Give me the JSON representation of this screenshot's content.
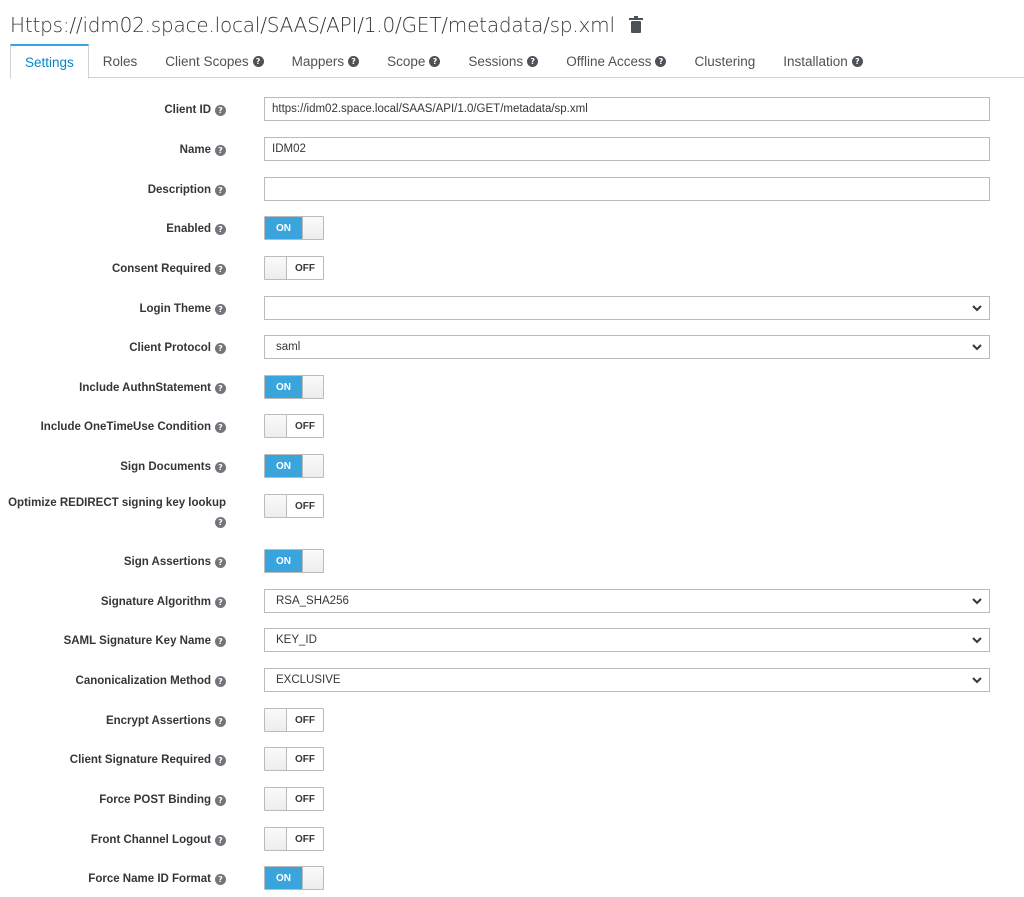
{
  "header": {
    "title": "Https://idm02.space.local/SAAS/API/1.0/GET/metadata/sp.xml",
    "delete_icon": "trash-icon"
  },
  "tabs": [
    {
      "label": "Settings",
      "active": true,
      "help": false
    },
    {
      "label": "Roles",
      "active": false,
      "help": false
    },
    {
      "label": "Client Scopes",
      "active": false,
      "help": true
    },
    {
      "label": "Mappers",
      "active": false,
      "help": true
    },
    {
      "label": "Scope",
      "active": false,
      "help": true
    },
    {
      "label": "Sessions",
      "active": false,
      "help": true
    },
    {
      "label": "Offline Access",
      "active": false,
      "help": true
    },
    {
      "label": "Clustering",
      "active": false,
      "help": false
    },
    {
      "label": "Installation",
      "active": false,
      "help": true
    }
  ],
  "form": {
    "client_id": {
      "label": "Client ID",
      "value": "https://idm02.space.local/SAAS/API/1.0/GET/metadata/sp.xml"
    },
    "name": {
      "label": "Name",
      "value": "IDM02"
    },
    "description": {
      "label": "Description",
      "value": ""
    },
    "enabled": {
      "label": "Enabled",
      "state": "ON"
    },
    "consent_required": {
      "label": "Consent Required",
      "state": "OFF"
    },
    "login_theme": {
      "label": "Login Theme",
      "value": ""
    },
    "client_protocol": {
      "label": "Client Protocol",
      "value": "saml"
    },
    "include_authn_statement": {
      "label": "Include AuthnStatement",
      "state": "ON"
    },
    "include_onetimeuse": {
      "label": "Include OneTimeUse Condition",
      "state": "OFF"
    },
    "sign_documents": {
      "label": "Sign Documents",
      "state": "ON"
    },
    "optimize_redirect": {
      "label": "Optimize REDIRECT signing key lookup",
      "state": "OFF"
    },
    "sign_assertions": {
      "label": "Sign Assertions",
      "state": "ON"
    },
    "signature_algorithm": {
      "label": "Signature Algorithm",
      "value": "RSA_SHA256"
    },
    "saml_signature_key_name": {
      "label": "SAML Signature Key Name",
      "value": "KEY_ID"
    },
    "canonicalization_method": {
      "label": "Canonicalization Method",
      "value": "EXCLUSIVE"
    },
    "encrypt_assertions": {
      "label": "Encrypt Assertions",
      "state": "OFF"
    },
    "client_signature_required": {
      "label": "Client Signature Required",
      "state": "OFF"
    },
    "force_post_binding": {
      "label": "Force POST Binding",
      "state": "OFF"
    },
    "front_channel_logout": {
      "label": "Front Channel Logout",
      "state": "OFF"
    },
    "force_name_id_format": {
      "label": "Force Name ID Format",
      "state": "ON"
    }
  },
  "help_glyph": "?",
  "colors": {
    "accent": "#39a5dc",
    "active_tab_text": "#0088ce"
  }
}
